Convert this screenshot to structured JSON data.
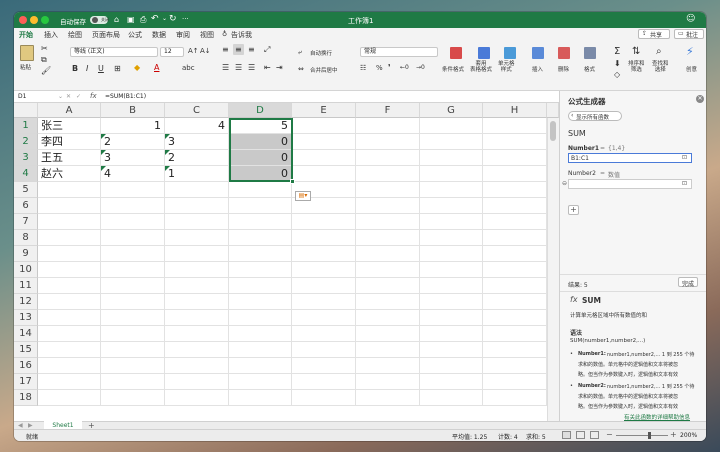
{
  "window": {
    "title": "工作簿1",
    "autosave_label": "自动保存",
    "autosave_toggle": "关闭",
    "share_label": "共享",
    "comment_label": "批注"
  },
  "tabs": [
    "开始",
    "插入",
    "绘图",
    "页面布局",
    "公式",
    "数据",
    "审阅",
    "视图"
  ],
  "tell_me": "告诉我",
  "ribbon": {
    "paste": "粘贴",
    "font_name": "等线 (正文)",
    "font_size": "12",
    "wrap_text": "自动换行",
    "merge_center": "合并后居中",
    "number_format": "常规",
    "cond_format": "条件格式",
    "table_format": "套用\n表格格式",
    "cell_style": "单元格\n样式",
    "insert": "插入",
    "delete": "删除",
    "format": "格式",
    "sort_filter": "排序和\n筛选",
    "find_select": "查找和\n选择",
    "ideas": "创意"
  },
  "formula_bar": {
    "name_box": "D1",
    "fx": "fx",
    "formula": "=SUM(B1:C1)"
  },
  "columns": [
    "A",
    "B",
    "C",
    "D",
    "E",
    "F",
    "G",
    "H"
  ],
  "rows": [
    {
      "num": "1",
      "A": "张三",
      "B": "1",
      "C": "4",
      "D": "5"
    },
    {
      "num": "2",
      "A": "李四",
      "B": "2",
      "C": "3",
      "D": "0"
    },
    {
      "num": "3",
      "A": "王五",
      "B": "3",
      "C": "2",
      "D": "0"
    },
    {
      "num": "4",
      "A": "赵六",
      "B": "4",
      "C": "1",
      "D": "0"
    },
    {
      "num": "5"
    },
    {
      "num": "6"
    },
    {
      "num": "7"
    },
    {
      "num": "8"
    },
    {
      "num": "9"
    },
    {
      "num": "10"
    },
    {
      "num": "11"
    },
    {
      "num": "12"
    },
    {
      "num": "13"
    },
    {
      "num": "14"
    },
    {
      "num": "15"
    },
    {
      "num": "16"
    },
    {
      "num": "17"
    },
    {
      "num": "18"
    }
  ],
  "panel": {
    "title": "公式生成器",
    "show_all": "显示所有函数",
    "func_name": "SUM",
    "number1_label": "Number1",
    "number1_eq": "=",
    "number1_preview": "{1,4}",
    "number1_value": "B1:C1",
    "number2_label": "Number2",
    "number2_eq": "=",
    "number2_preview": "数值",
    "result_label": "结果: 5",
    "done": "完成",
    "fx_sym": "fx",
    "sum_title": "SUM",
    "sum_desc": "计算单元格区域中所有数值的和",
    "syntax_title": "语法",
    "syntax": "SUM(number1,number2,...)",
    "n1_name": "Number1:",
    "n1_desc1": "number1,number2,... 1 到 255 个待",
    "n1_desc2": "求和的数值。单元格中的逻辑值和文本将被忽",
    "n1_desc3": "略。但当作为参数键入时，逻辑值和文本有效",
    "n2_name": "Number2:",
    "n2_desc1": "number1,number2,... 1 到 255 个待",
    "n2_desc2": "求和的数值。单元格中的逻辑值和文本将被忽",
    "n2_desc3": "略。但当作为参数键入时，逻辑值和文本有效",
    "help_link": "有关此函数的详细帮助信息"
  },
  "sheet_tab": "Sheet1",
  "status": {
    "ready": "就绪",
    "average": "平均值: 1.25",
    "count": "计数: 4",
    "sum": "求和: 5",
    "zoom": "200%"
  },
  "colors": {
    "brand": "#1f7a45",
    "selection": "#c9c9c9"
  }
}
